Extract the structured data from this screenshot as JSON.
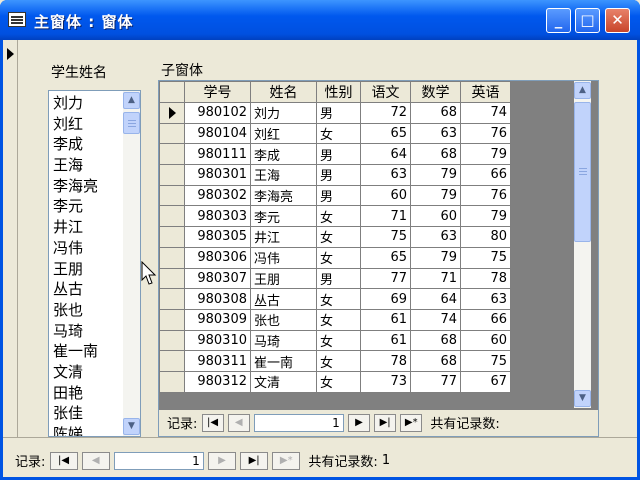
{
  "window": {
    "title": "主窗体 : 窗体",
    "minimize": "_",
    "maximize": "□",
    "close": "✕"
  },
  "main": {
    "list_label": "学生姓名",
    "subform_label": "子窗体",
    "students": [
      "刘力",
      "刘红",
      "李成",
      "王海",
      "李海亮",
      "李元",
      "井江",
      "冯伟",
      "王朋",
      "丛古",
      "张也",
      "马琦",
      "崔一南",
      "文清",
      "田艳",
      "张佳",
      "陈娣"
    ]
  },
  "grid": {
    "headers": [
      "学号",
      "姓名",
      "性别",
      "语文",
      "数学",
      "英语"
    ],
    "rows": [
      [
        "980102",
        "刘力",
        "男",
        "72",
        "68",
        "74"
      ],
      [
        "980104",
        "刘红",
        "女",
        "65",
        "63",
        "76"
      ],
      [
        "980111",
        "李成",
        "男",
        "64",
        "68",
        "79"
      ],
      [
        "980301",
        "王海",
        "男",
        "63",
        "79",
        "66"
      ],
      [
        "980302",
        "李海亮",
        "男",
        "60",
        "79",
        "76"
      ],
      [
        "980303",
        "李元",
        "女",
        "71",
        "60",
        "79"
      ],
      [
        "980305",
        "井江",
        "女",
        "75",
        "63",
        "80"
      ],
      [
        "980306",
        "冯伟",
        "女",
        "65",
        "79",
        "75"
      ],
      [
        "980307",
        "王朋",
        "男",
        "77",
        "71",
        "78"
      ],
      [
        "980308",
        "丛古",
        "女",
        "69",
        "64",
        "63"
      ],
      [
        "980309",
        "张也",
        "女",
        "61",
        "74",
        "66"
      ],
      [
        "980310",
        "马琦",
        "女",
        "61",
        "68",
        "60"
      ],
      [
        "980311",
        "崔一南",
        "女",
        "78",
        "68",
        "75"
      ],
      [
        "980312",
        "文清",
        "女",
        "73",
        "77",
        "67"
      ]
    ]
  },
  "sub_nav": {
    "label": "记录:",
    "current": "1",
    "total_label": "共有记录数:"
  },
  "main_nav": {
    "label": "记录:",
    "current": "1",
    "total_label": "共有记录数:",
    "total": "1"
  }
}
